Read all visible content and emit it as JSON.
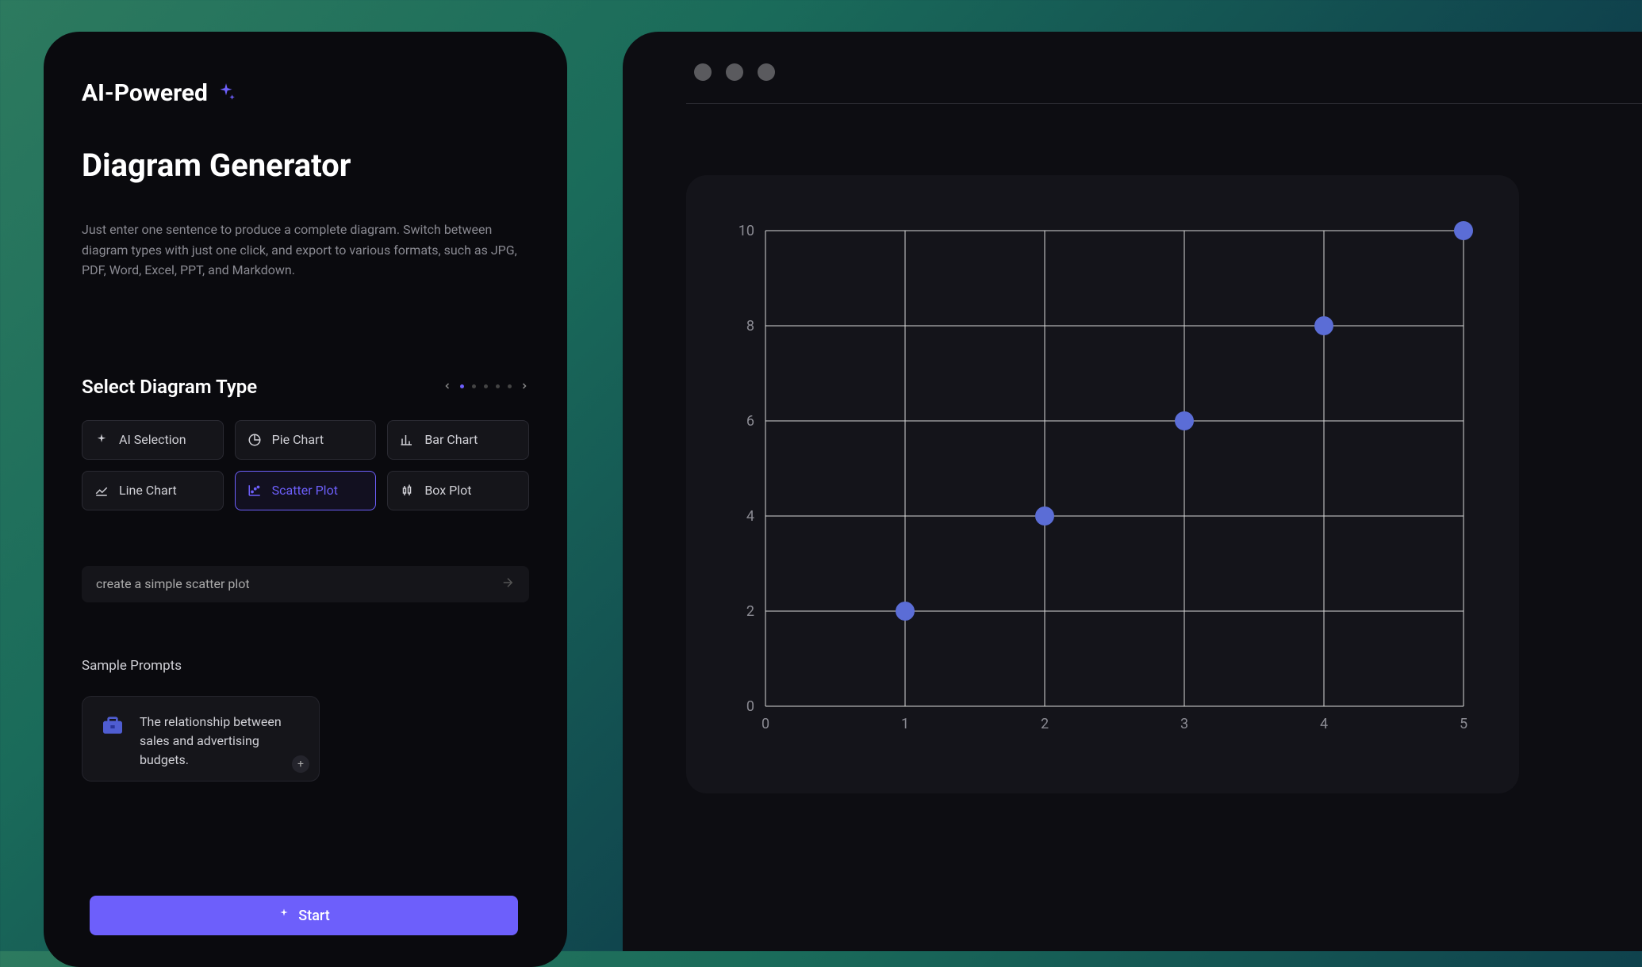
{
  "brand": {
    "label": "AI-Powered"
  },
  "page": {
    "title": "Diagram Generator",
    "description": "Just enter one sentence to produce a complete diagram. Switch between diagram types with just one click, and export to various formats, such as JPG, PDF, Word, Excel, PPT, and Markdown."
  },
  "select": {
    "title": "Select Diagram Type",
    "types": [
      {
        "label": "AI Selection",
        "icon": "sparkle"
      },
      {
        "label": "Pie Chart",
        "icon": "pie"
      },
      {
        "label": "Bar Chart",
        "icon": "bar"
      },
      {
        "label": "Line Chart",
        "icon": "line"
      },
      {
        "label": "Scatter Plot",
        "icon": "scatter",
        "selected": true
      },
      {
        "label": "Box Plot",
        "icon": "box"
      }
    ]
  },
  "prompt": {
    "value": "create a simple scatter plot"
  },
  "sample": {
    "title": "Sample Prompts",
    "card": {
      "text": "The relationship between sales and advertising budgets."
    }
  },
  "start_button": "Start",
  "chart_data": {
    "type": "scatter",
    "x": [
      1,
      2,
      3,
      4,
      5
    ],
    "y": [
      2,
      4,
      6,
      8,
      10
    ],
    "xlim": [
      0,
      5
    ],
    "ylim": [
      0,
      10
    ],
    "xticks": [
      0,
      1,
      2,
      3,
      4,
      5
    ],
    "yticks": [
      0,
      2,
      4,
      6,
      8,
      10
    ]
  }
}
